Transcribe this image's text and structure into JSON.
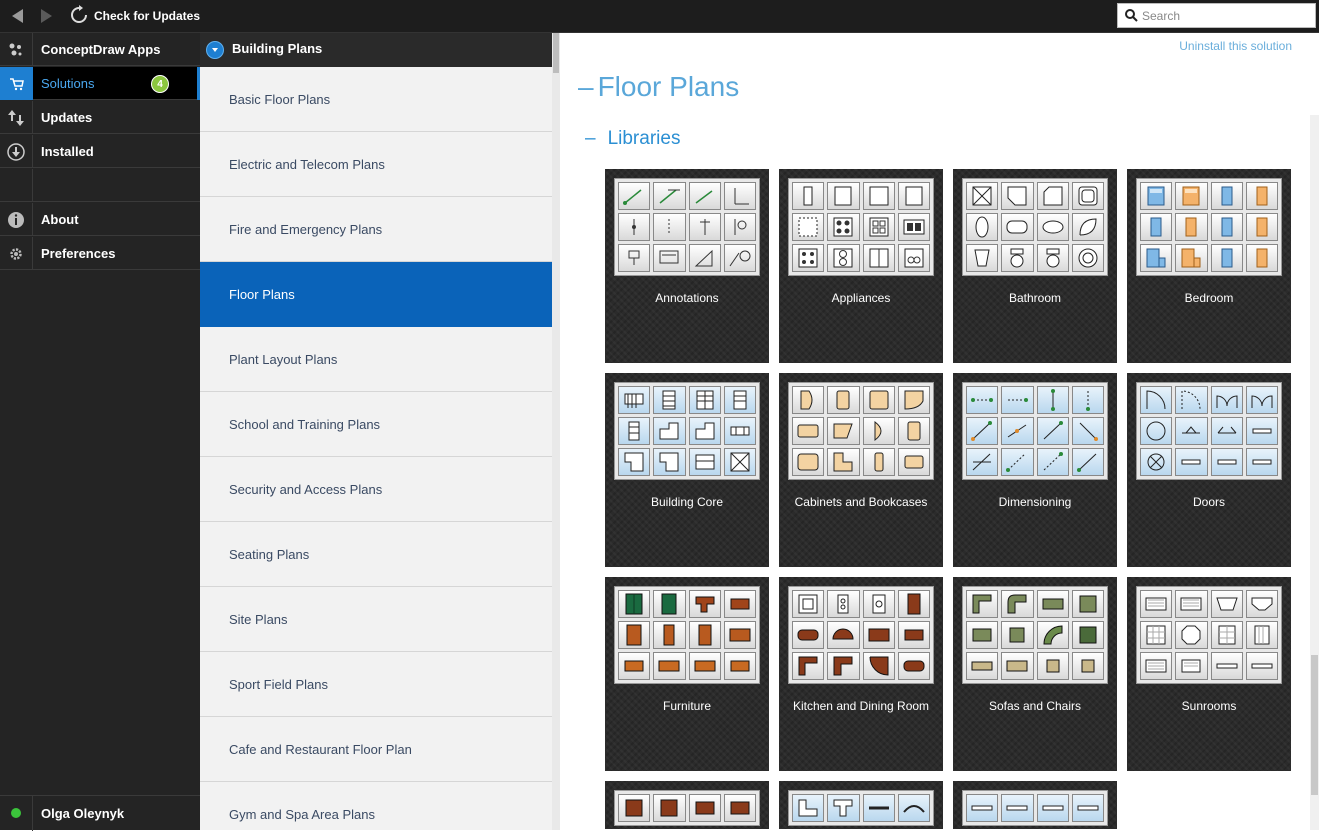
{
  "topbar": {
    "check_updates": "Check for Updates",
    "search_placeholder": "Search"
  },
  "left_nav": {
    "items": [
      {
        "label": "ConceptDraw Apps",
        "icon": "apps-icon"
      },
      {
        "label": "Solutions",
        "icon": "cart-icon",
        "badge": "4"
      },
      {
        "label": "Updates",
        "icon": "updates-icon"
      },
      {
        "label": "Installed",
        "icon": "download-icon"
      },
      {
        "label": "",
        "icon": ""
      },
      {
        "label": "About",
        "icon": "info-icon"
      },
      {
        "label": "Preferences",
        "icon": "gear-icon"
      }
    ],
    "user": "Olga Oleynyk"
  },
  "solutions_panel": {
    "header": "Building Plans",
    "items": [
      "Basic Floor Plans",
      "Electric and Telecom Plans",
      "Fire and Emergency Plans",
      "Floor Plans",
      "Plant Layout Plans",
      "School and Training Plans",
      "Security and Access Plans",
      "Seating Plans",
      "Site Plans",
      "Sport Field Plans",
      "Cafe and Restaurant Floor Plan",
      "Gym and Spa Area Plans"
    ],
    "selected": "Floor Plans"
  },
  "content": {
    "uninstall": "Uninstall this solution",
    "title": "Floor Plans",
    "section": "Libraries",
    "libraries": [
      "Annotations",
      "Appliances",
      "Bathroom",
      "Bedroom",
      "Building Core",
      "Cabinets and Bookcases",
      "Dimensioning",
      "Doors",
      "Furniture",
      "Kitchen and Dining Room",
      "Sofas and Chairs",
      "Sunrooms"
    ]
  }
}
